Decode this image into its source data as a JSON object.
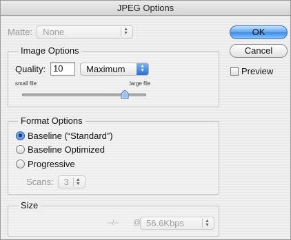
{
  "window": {
    "title": "JPEG Options"
  },
  "matte": {
    "label": "Matte:",
    "value": "None"
  },
  "image_options": {
    "title": "Image Options",
    "quality_label": "Quality:",
    "quality_value": "10",
    "quality_preset": "Maximum",
    "small_label": "small file",
    "large_label": "large file",
    "slider_fraction": 0.83
  },
  "format_options": {
    "title": "Format Options",
    "options": [
      {
        "label": "Baseline (“Standard”)",
        "selected": true
      },
      {
        "label": "Baseline Optimized",
        "selected": false
      },
      {
        "label": "Progressive",
        "selected": false
      }
    ],
    "scans_label": "Scans:",
    "scans_value": "3"
  },
  "size": {
    "title": "Size",
    "estimate": "--/--",
    "at": "@",
    "speed": "56.6Kbps"
  },
  "buttons": {
    "ok": "OK",
    "cancel": "Cancel",
    "preview": "Preview"
  }
}
